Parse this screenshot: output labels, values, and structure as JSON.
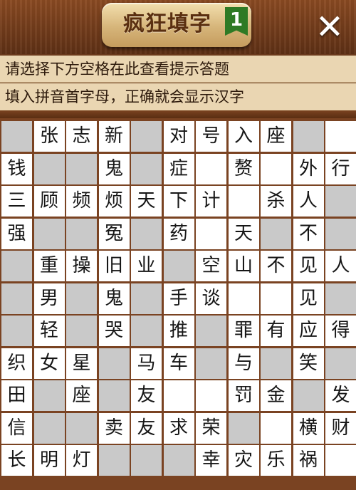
{
  "header": {
    "title": "疯狂填字",
    "level": "1",
    "close_icon": "close-icon"
  },
  "hints": {
    "line1": "请选择下方空格在此查看提示答题",
    "line2": "填入拼音首字母，正确就会显示汉字"
  },
  "board": {
    "cols": 11,
    "rows": 11,
    "cells": [
      [
        "",
        "张",
        "志",
        "新",
        "",
        "对",
        "号",
        "入",
        "座",
        "",
        ""
      ],
      [
        "钱",
        "",
        "",
        "鬼",
        "",
        "症",
        "",
        "赘",
        "",
        "外",
        "行"
      ],
      [
        "三",
        "顾",
        "频",
        "烦",
        "天",
        "下",
        "计",
        "",
        "杀",
        "人",
        ""
      ],
      [
        "强",
        "",
        "",
        "冤",
        "",
        "药",
        "",
        "天",
        "",
        "不",
        ""
      ],
      [
        "",
        "重",
        "操",
        "旧",
        "业",
        "",
        "空",
        "山",
        "不",
        "见",
        "人"
      ],
      [
        "",
        "男",
        "",
        "鬼",
        "",
        "手",
        "谈",
        "",
        "",
        "见",
        ""
      ],
      [
        "",
        "轻",
        "",
        "哭",
        "",
        "推",
        "",
        "罪",
        "有",
        "应",
        "得"
      ],
      [
        "织",
        "女",
        "星",
        "",
        "马",
        "车",
        "",
        "与",
        "",
        "笑",
        ""
      ],
      [
        "田",
        "",
        "座",
        "",
        "友",
        "",
        "",
        "罚",
        "金",
        "",
        "发"
      ],
      [
        "信",
        "",
        "",
        "卖",
        "友",
        "求",
        "荣",
        "",
        "",
        "横",
        "财"
      ],
      [
        "长",
        "明",
        "灯",
        "",
        "",
        "",
        "幸",
        "灾",
        "乐",
        "祸",
        ""
      ]
    ],
    "empty_cells": [
      [
        0,
        10
      ],
      [
        1,
        6
      ],
      [
        1,
        8
      ],
      [
        2,
        7
      ],
      [
        3,
        6
      ],
      [
        5,
        7
      ],
      [
        5,
        8
      ],
      [
        8,
        5
      ],
      [
        8,
        6
      ],
      [
        9,
        8
      ],
      [
        10,
        10
      ]
    ]
  }
}
